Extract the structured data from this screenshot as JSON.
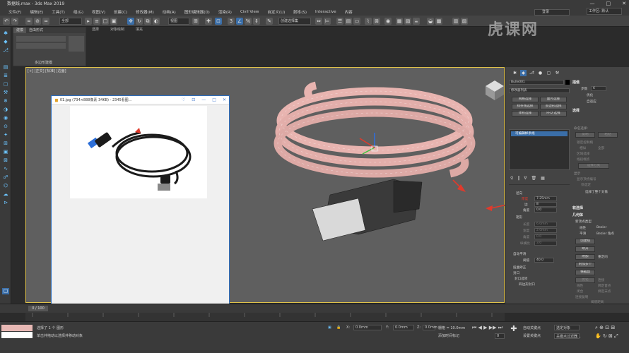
{
  "window": {
    "title": "数据线.max - 3ds Max 2019",
    "controls": [
      "—",
      "□",
      "✕"
    ]
  },
  "menu": [
    "文件(F)",
    "编辑(E)",
    "工具(T)",
    "组(G)",
    "视图(V)",
    "创建(C)",
    "修改器(M)",
    "动画(A)",
    "图形编辑器(D)",
    "渲染(R)",
    "Civil View",
    "自定义(U)",
    "脚本(S)",
    "Interactive",
    "内容"
  ],
  "toolbar": {
    "selection_filter": "全部",
    "ref_coord": "视图",
    "named_set": "创建选择集",
    "workspace": "工作区: 默认",
    "user": "登录"
  },
  "ribbon": {
    "tabs": [
      "建模",
      "自由形式",
      "选择",
      "对象绘制",
      "填充"
    ],
    "panel_label": "多边形建模"
  },
  "viewport": {
    "label": "[+] [正交] [标准] [边面]"
  },
  "image_viewer": {
    "title": "01.jpg  (734×888像素 34KB) - 2345看图...",
    "buttons": [
      "♡",
      "⊡",
      "—",
      "□",
      "✕"
    ]
  },
  "command_panel": {
    "object_name": "Bulle001",
    "modifier_list": "修改器列表",
    "buttons": [
      "网格选择",
      "面片选择",
      "样条线选择",
      "多边形选择",
      "体积选择",
      "FFD 选择"
    ],
    "stack_item": "可编辑样条线",
    "rendering": {
      "radial_label": "径向",
      "thickness_label": "厚度",
      "thickness_value": "7.25mm",
      "sides_label": "边",
      "sides_value": "8",
      "angle_label": "角度",
      "angle_value": "0.0",
      "rect_label": "矩形",
      "length_label": "长度",
      "length_value": "6.0mm",
      "width_label": "宽度",
      "width_value": "2.0mm",
      "rect_angle_label": "角度",
      "rect_angle_value": "0.0",
      "aspect_label": "纵横比",
      "aspect_value": "3.0",
      "auto_smooth": "自动平滑",
      "threshold_label": "阈值",
      "threshold_value": "40.0",
      "torsion_label": "扭曲矫正",
      "cap_label": "封口",
      "cap_options": "封口选项",
      "quad_cap": "四边形封口"
    },
    "right": {
      "interpolation": "插值",
      "steps_label": "步数",
      "steps_value": "6",
      "optimize": "优化",
      "adaptive": "自适应",
      "selection": "选择",
      "named_sel": "命名选择:",
      "copy": "复制",
      "paste": "粘贴",
      "lock_handles": "锁定控制柄",
      "similar": "相似",
      "all": "全部",
      "area_select": "区域选择",
      "segment_end": "线段端点",
      "select_by": "选择方式",
      "display": "显示",
      "show_vertex": "显示顶点编号",
      "selected_only": "仅选定",
      "selected_count": "选择了整个对象",
      "soft_sel": "软选择",
      "geometry": "几何体",
      "new_vertex_type": "新顶点类型",
      "linear": "线性",
      "bezier": "Bezier",
      "smooth": "平滑",
      "bezier_corner": "Bezier 角点",
      "create_line": "创建线",
      "break": "断开",
      "attach": "附加",
      "reorient": "重定向",
      "attach_mult": "附加多个",
      "cross_section": "横截面",
      "refine": "优化",
      "connect": "连接",
      "linear2": "线性",
      "bind_first": "绑定首点",
      "closed": "闭合",
      "bind_last": "绑定末点",
      "connect_copy": "连接复制",
      "threshold_dist": "阈值距离"
    }
  },
  "timeline": {
    "frame": "0 / 100"
  },
  "status": {
    "selected": "选择了 1 个 图形",
    "prompt": "单击并拖动以选择并移动对象",
    "x_label": "X:",
    "x_value": "0.0mm",
    "y_label": "Y:",
    "y_value": "0.0mm",
    "z_label": "Z:",
    "z_value": "0.0mm",
    "grid": "栅格 = 10.0mm",
    "add_tag": "添加时间标记",
    "auto_key": "自动关键点",
    "selected_obj": "选定对象",
    "set_key": "设置关键点",
    "key_filter": "关键点过滤器...",
    "frame_field": "0"
  },
  "watermark": "虎课网"
}
